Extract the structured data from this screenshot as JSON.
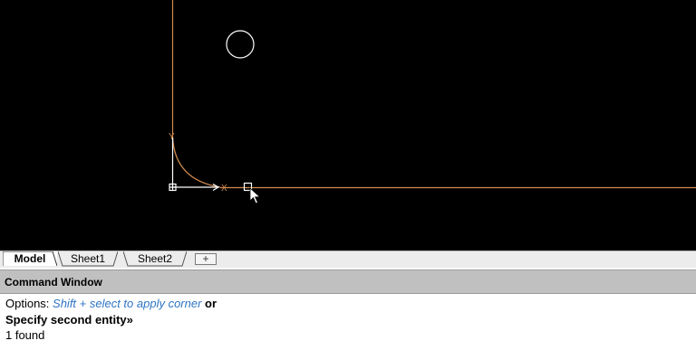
{
  "tabs": {
    "model": "Model",
    "sheet1": "Sheet1",
    "sheet2": "Sheet2",
    "add": "+"
  },
  "axes": {
    "y_label": "Y",
    "x_label": "X"
  },
  "command_window": {
    "title": "Command Window",
    "options_prefix": "Options: ",
    "options_link": "Shift + select to apply corner",
    "options_suffix": " or",
    "prompt": "Specify second entity»",
    "result": "1 found"
  },
  "colors": {
    "canvas_bg": "#000000",
    "entity_line": "#d08a4e",
    "circle": "#ffffff",
    "ucs": "#ffffff",
    "link": "#2f75c4"
  }
}
